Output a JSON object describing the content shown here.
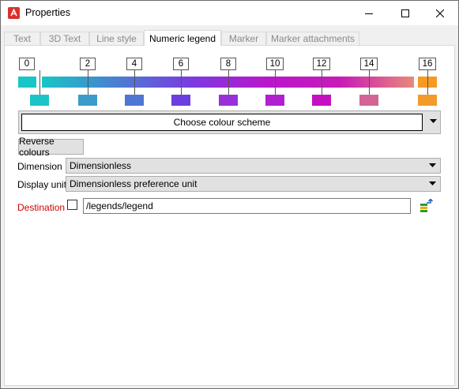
{
  "window": {
    "title": "Properties",
    "app_icon": "app-logo-icon",
    "controls": [
      "minimize-icon",
      "maximize-icon",
      "close-icon"
    ]
  },
  "tabs": [
    {
      "label": "Text",
      "active": false
    },
    {
      "label": "3D Text",
      "active": false
    },
    {
      "label": "Line style",
      "active": false
    },
    {
      "label": "Numeric legend",
      "active": true
    },
    {
      "label": "Marker",
      "active": false
    },
    {
      "label": "Marker attachments",
      "active": false
    }
  ],
  "legend": {
    "ticks": [
      "0",
      "2",
      "4",
      "6",
      "8",
      "10",
      "12",
      "14",
      "16"
    ],
    "swatch_colors": [
      "#1cc4c8",
      "#3b9ccb",
      "#4f76d4",
      "#6a3ee0",
      "#9830d8",
      "#b11fd0",
      "#c60fc0",
      "#d36496",
      "#f29a2a"
    ],
    "gradient_colors": [
      "#17c6c6",
      "#4a7fd2",
      "#7a3be0",
      "#b818cc",
      "#c81ab8",
      "#e9897a",
      "#f59a24"
    ]
  },
  "scheme": {
    "button_label": "Choose colour scheme"
  },
  "reverse": {
    "label": "Reverse colours"
  },
  "dimension": {
    "label": "Dimension",
    "value": "Dimensionless"
  },
  "display_unit": {
    "label": "Display unit",
    "value": "Dimensionless preference unit"
  },
  "destination": {
    "label": "Destination",
    "value": "/legends/legend",
    "checked": false,
    "icon": "browse-tree-icon"
  },
  "colors": {
    "destination_label": "#d00000",
    "accent": "#d9302b"
  }
}
